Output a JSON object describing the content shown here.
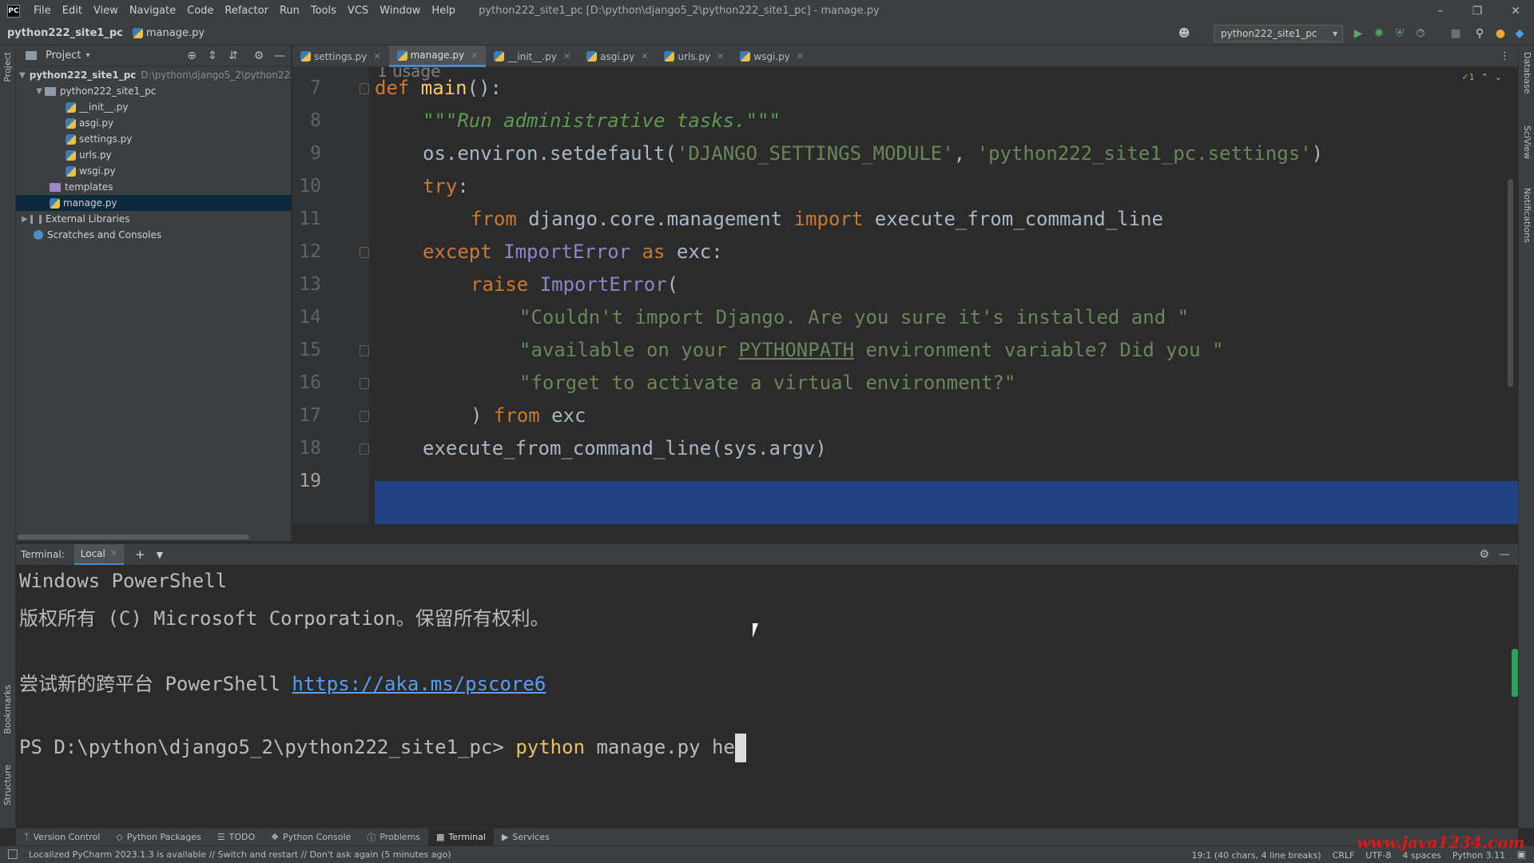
{
  "titlebar": {
    "app_logo": "PC",
    "menu": [
      "File",
      "Edit",
      "View",
      "Navigate",
      "Code",
      "Refactor",
      "Run",
      "Tools",
      "VCS",
      "Window",
      "Help"
    ],
    "window_title": "python222_site1_pc [D:\\python\\django5_2\\python222_site1_pc] - manage.py"
  },
  "navbar": {
    "project": "python222_site1_pc",
    "file": "manage.py",
    "run_config": "python222_site1_pc"
  },
  "left_strip": {
    "project": "Project",
    "bookmarks": "Bookmarks",
    "structure": "Structure"
  },
  "right_strip": {
    "database": "Database",
    "sciview": "SciView",
    "notifications": "Notifications"
  },
  "project_panel": {
    "title": "Project",
    "root": "python222_site1_pc",
    "root_path": "D:\\python\\django5_2\\python222_site1_pc",
    "package": "python222_site1_pc",
    "files": [
      "__init__.py",
      "asgi.py",
      "settings.py",
      "urls.py",
      "wsgi.py"
    ],
    "templates": "templates",
    "manage": "manage.py",
    "external": "External Libraries",
    "scratches": "Scratches and Consoles"
  },
  "editor_tabs": [
    "settings.py",
    "manage.py",
    "__init__.py",
    "asgi.py",
    "urls.py",
    "wsgi.py"
  ],
  "editor": {
    "usage_hint": "1 usage",
    "inspection_count": "1",
    "line_numbers": [
      "7",
      "8",
      "9",
      "10",
      "11",
      "12",
      "13",
      "14",
      "15",
      "16",
      "17",
      "18",
      "19"
    ],
    "code": {
      "l7_kw": "def ",
      "l7_fn": "main",
      "l7_rest": "():",
      "l8": "\"\"\"Run administrative tasks.\"\"\"",
      "l9_a": "os.environ.setdefault(",
      "l9_s1": "'DJANGO_SETTINGS_MODULE'",
      "l9_b": ", ",
      "l9_s2": "'python222_site1_pc.settings'",
      "l9_c": ")",
      "l10": "try",
      "l11_kw1": "from ",
      "l11_mod": "django.core.management ",
      "l11_kw2": "import ",
      "l11_name": "execute_from_command_line",
      "l12_kw1": "except ",
      "l12_cls": "ImportError ",
      "l12_kw2": "as ",
      "l12_rest": "exc:",
      "l13_kw": "raise ",
      "l13_cls": "ImportError",
      "l13_rest": "(",
      "l14": "\"Couldn't import Django. Are you sure it's installed and \"",
      "l15_a": "\"available on your ",
      "l15_p": "PYTHONPATH",
      "l15_b": " environment variable? Did you \"",
      "l16": "\"forget to activate a virtual environment?\"",
      "l17_a": ") ",
      "l17_kw": "from ",
      "l17_b": "exc",
      "l18": "execute_from_command_line(sys.argv)"
    }
  },
  "terminal": {
    "title": "Terminal:",
    "tab": "Local",
    "line1": "Windows PowerShell",
    "line2": "版权所有 (C) Microsoft Corporation。保留所有权利。",
    "line3_a": "尝试新的跨平台 PowerShell ",
    "line3_link": "https://aka.ms/pscore6",
    "prompt": "PS D:\\python\\django5_2\\python222_site1_pc> ",
    "cmd": "python",
    "args": " manage.py he"
  },
  "toolwindows": [
    "Version Control",
    "Python Packages",
    "TODO",
    "Python Console",
    "Problems",
    "Terminal",
    "Services"
  ],
  "statusbar": {
    "message": "Localized PyCharm 2023.1.3 is available // Switch and restart // Don't ask again (5 minutes ago)",
    "position": "19:1 (40 chars, 4 line breaks)",
    "line_sep": "CRLF",
    "encoding": "UTF-8",
    "indent": "4 spaces",
    "interpreter": "Python 3.11"
  },
  "watermark": "www.java1234.com"
}
